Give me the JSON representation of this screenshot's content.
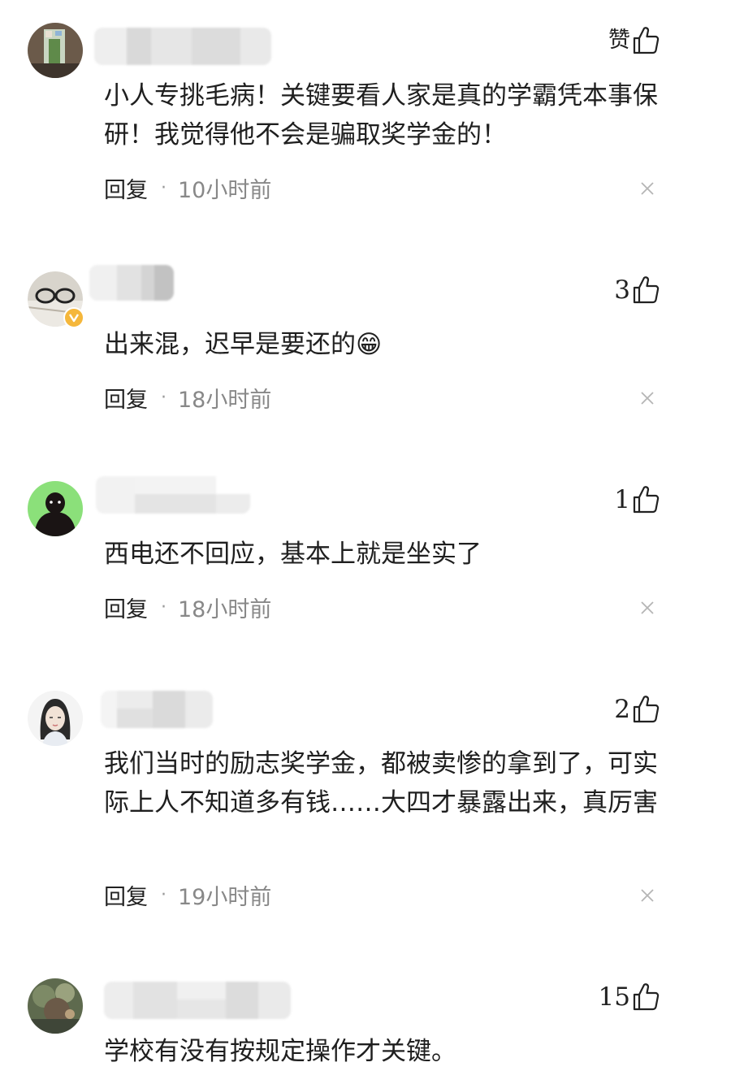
{
  "labels": {
    "reply": "回复",
    "separator": "·",
    "like_word": "赞"
  },
  "comments": [
    {
      "like_count": "",
      "like_text": "赞",
      "content": "小人专挑毛病！关键要看人家是真的学霸凭本事保研！我觉得他不会是骗取奖学金的！",
      "time": "10小时前"
    },
    {
      "like_count": "3",
      "content": "出来混，迟早是要还的😁",
      "time": "18小时前"
    },
    {
      "like_count": "1",
      "content": "西电还不回应，基本上就是坐实了",
      "time": "18小时前"
    },
    {
      "like_count": "2",
      "content": "我们当时的励志奖学金，都被卖惨的拿到了，可实际上人不知道多有钱……大四才暴露出来，真厉害",
      "time": "19小时前"
    },
    {
      "like_count": "15",
      "content": "学校有没有按规定操作才关键。",
      "time": ""
    }
  ],
  "colors": {
    "text": "#1f1f1f",
    "meta_time": "#888888",
    "verified_badge": "#f5b73b",
    "avatar3_bg": "#8be07a"
  }
}
